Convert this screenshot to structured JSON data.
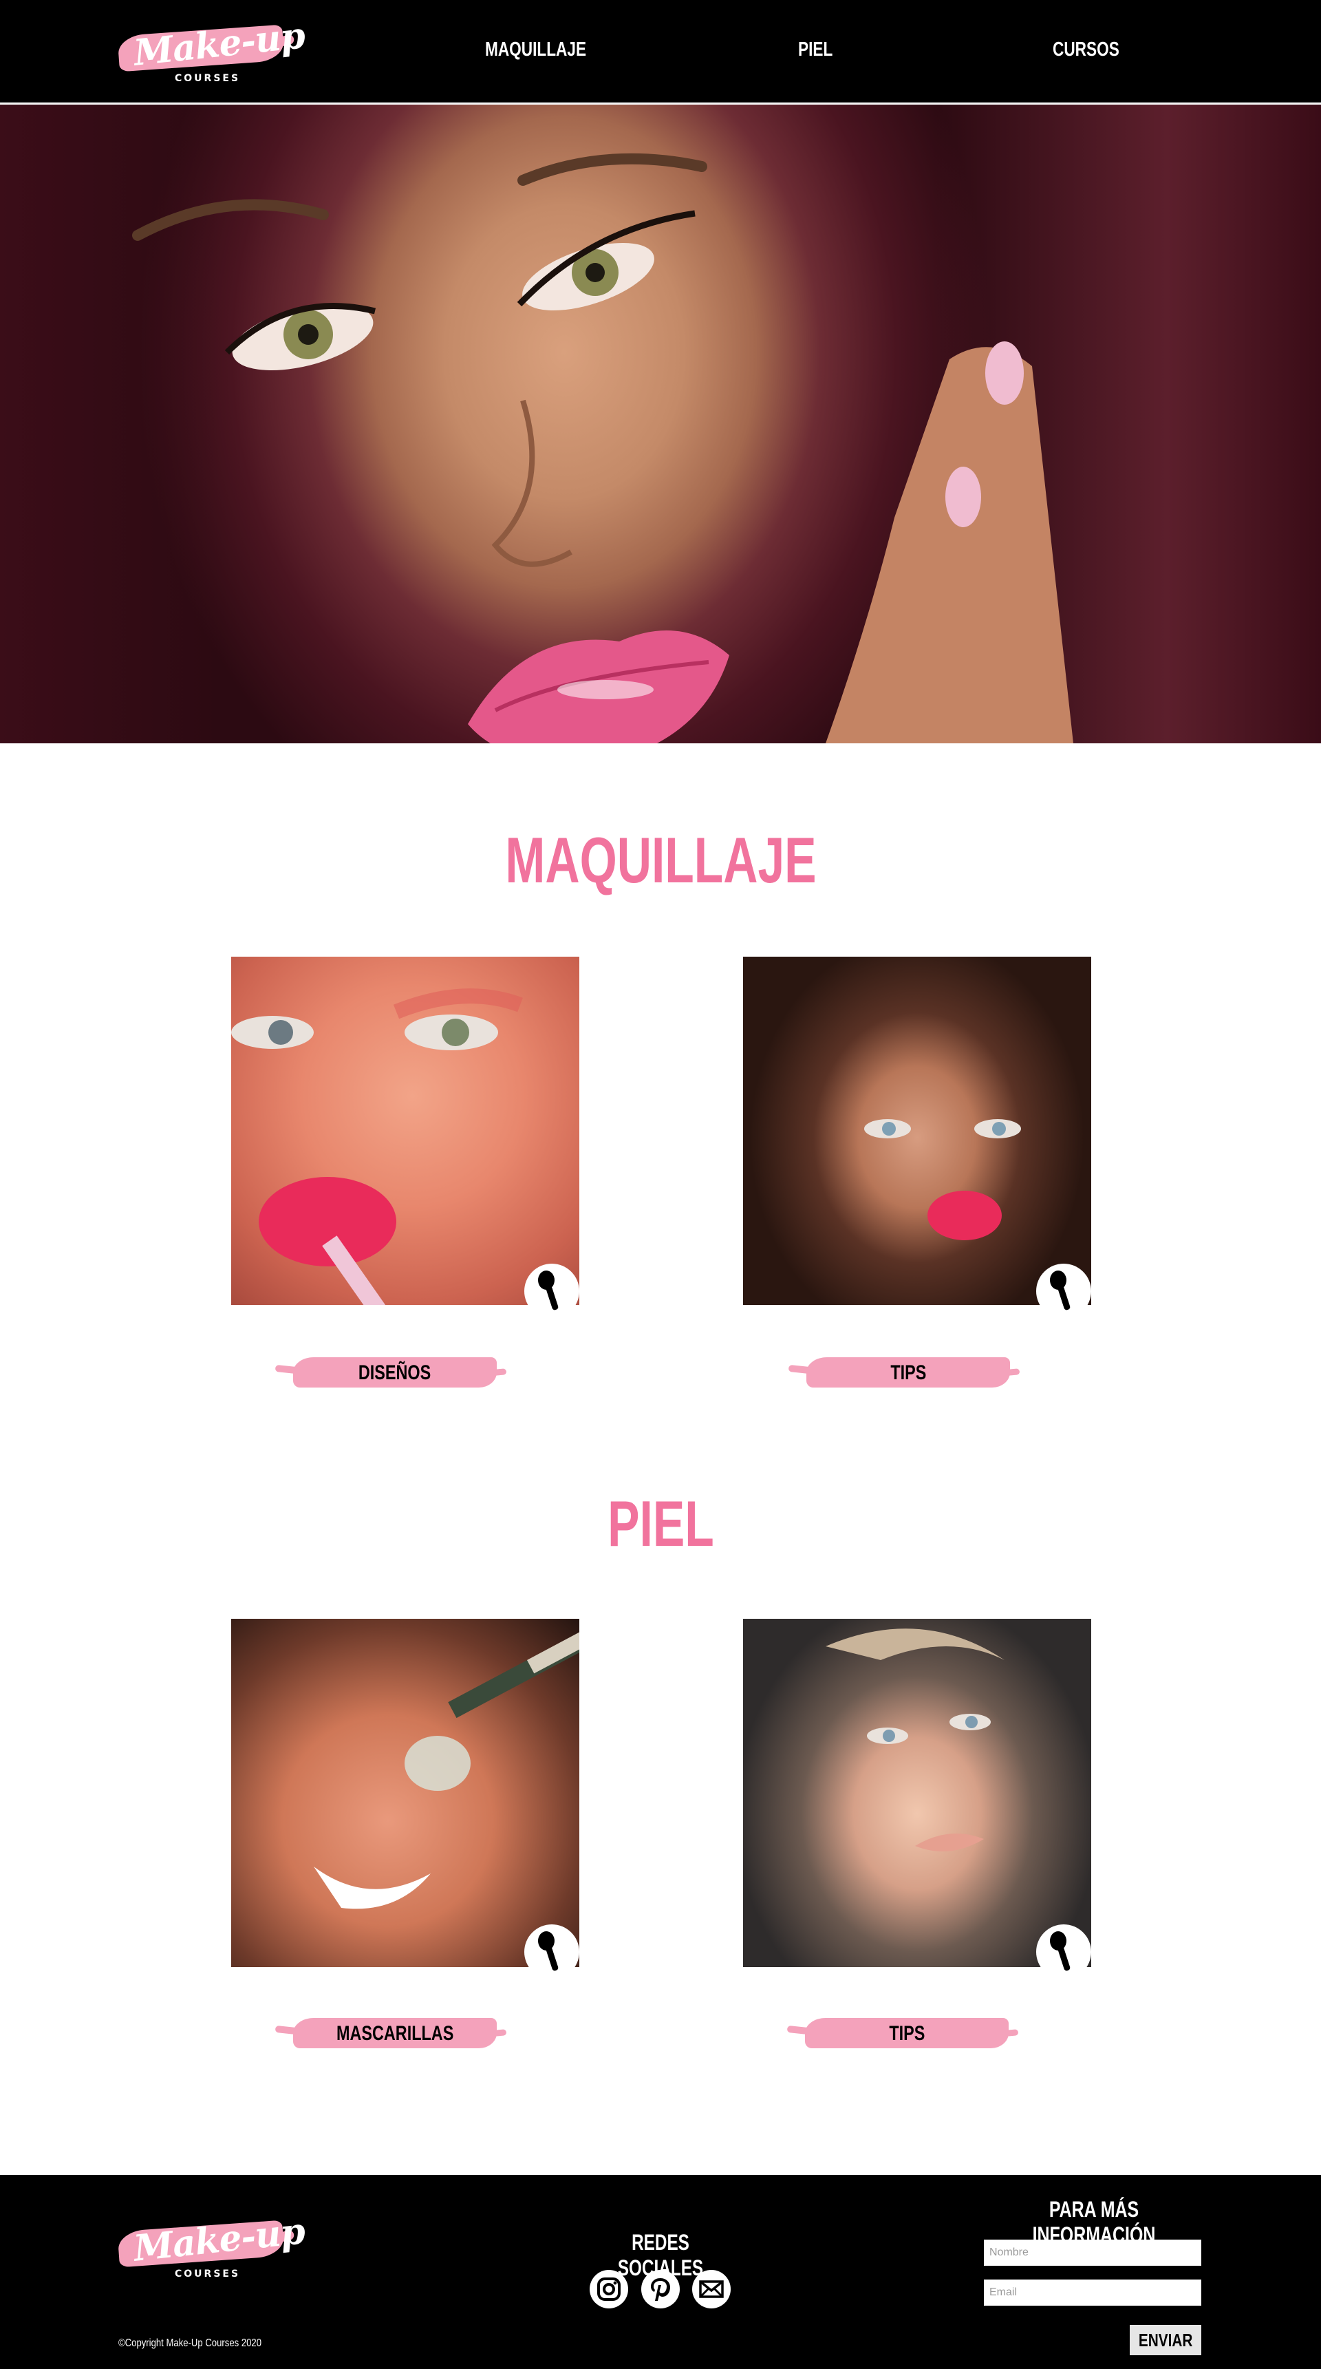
{
  "brand": {
    "logo_script": "Make-up",
    "logo_sub": "COURSES"
  },
  "nav": {
    "items": [
      {
        "label": "MAQUILLAJE"
      },
      {
        "label": "PIEL"
      },
      {
        "label": "CURSOS"
      }
    ]
  },
  "hero": {
    "image": "woman-pink-lips-portrait"
  },
  "sections": [
    {
      "title": "MAQUILLAJE",
      "cards": [
        {
          "label": "DISEÑOS",
          "image": "pink-eyeshadow-lipgloss",
          "icon": "makeup-brush-icon"
        },
        {
          "label": "TIPS",
          "image": "curly-hair-red-lips",
          "icon": "makeup-brush-icon"
        }
      ]
    },
    {
      "title": "PIEL",
      "cards": [
        {
          "label": "MASCARILLAS",
          "image": "smiling-woman-face-mask-brush",
          "icon": "makeup-brush-icon"
        },
        {
          "label": "TIPS",
          "image": "blonde-woman-glowing-skin",
          "icon": "makeup-brush-icon"
        }
      ]
    }
  ],
  "footer": {
    "copyright": "©Copyright Make-Up Courses 2020",
    "social": {
      "title": "REDES SOCIALES",
      "icons": [
        "instagram-icon",
        "pinterest-icon",
        "mail-icon"
      ]
    },
    "contact": {
      "title": "PARA MÁS INFORMACIÓN",
      "name_placeholder": "Nombre",
      "email_placeholder": "Email",
      "submit_label": "ENVIAR"
    }
  },
  "colors": {
    "accent_pink": "#f1739d",
    "brush_pink": "#f4a2bb",
    "header_bg": "#000000"
  }
}
